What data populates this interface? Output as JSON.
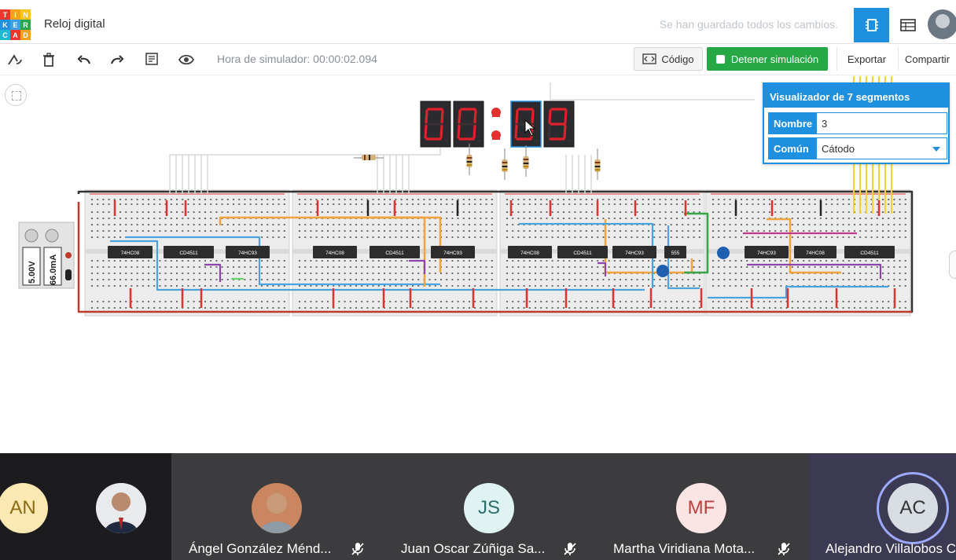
{
  "app": {
    "logo_letters": [
      "TIN",
      "KER",
      "CAD"
    ],
    "title": "Reloj digital",
    "save_status": "Se han guardado todos los cambios."
  },
  "toolbar": {
    "sim_time": "Hora de simulador: 00:00:02.094",
    "code_label": "Código",
    "stop_label": "Detener simulación",
    "export_label": "Exportar",
    "share_label": "Compartir"
  },
  "displays": {
    "digits": [
      "0",
      "0",
      "0",
      "9"
    ]
  },
  "chips": {
    "labels": [
      "74HC08",
      "CD4511",
      "74HC93",
      "74HC08",
      "CD4511",
      "74HC93",
      "74HC08",
      "CD4511",
      "74HC93",
      "555",
      "74HC93",
      "74HC08",
      "CD4511"
    ]
  },
  "power_supply": {
    "voltage": "5.00V",
    "current": "66.0mA"
  },
  "properties": {
    "title": "Visualizador de 7 segmentos",
    "name_label": "Nombre",
    "name_value": "3",
    "common_label": "Común",
    "common_value": "Cátodo"
  },
  "participants": [
    {
      "initials": "AN",
      "name": "",
      "color": "#fce8b2"
    },
    {
      "initials": "",
      "name": "Ángel González Ménd...",
      "color": "#9aa0a6"
    },
    {
      "initials": "JS",
      "name": "Juan Oscar Zúñiga Sa...",
      "color": "#e0f3f3"
    },
    {
      "initials": "MF",
      "name": "Martha Viridiana Mota...",
      "color": "#fbe4e4"
    },
    {
      "initials": "AC",
      "name": "Alejandro Villalobos C",
      "color": "#d7dde2"
    }
  ],
  "colors": {
    "accent": "#1f8fe0",
    "run_green": "#26a844",
    "segment_red": "#e0202a",
    "display_body": "#2b2b2f"
  }
}
